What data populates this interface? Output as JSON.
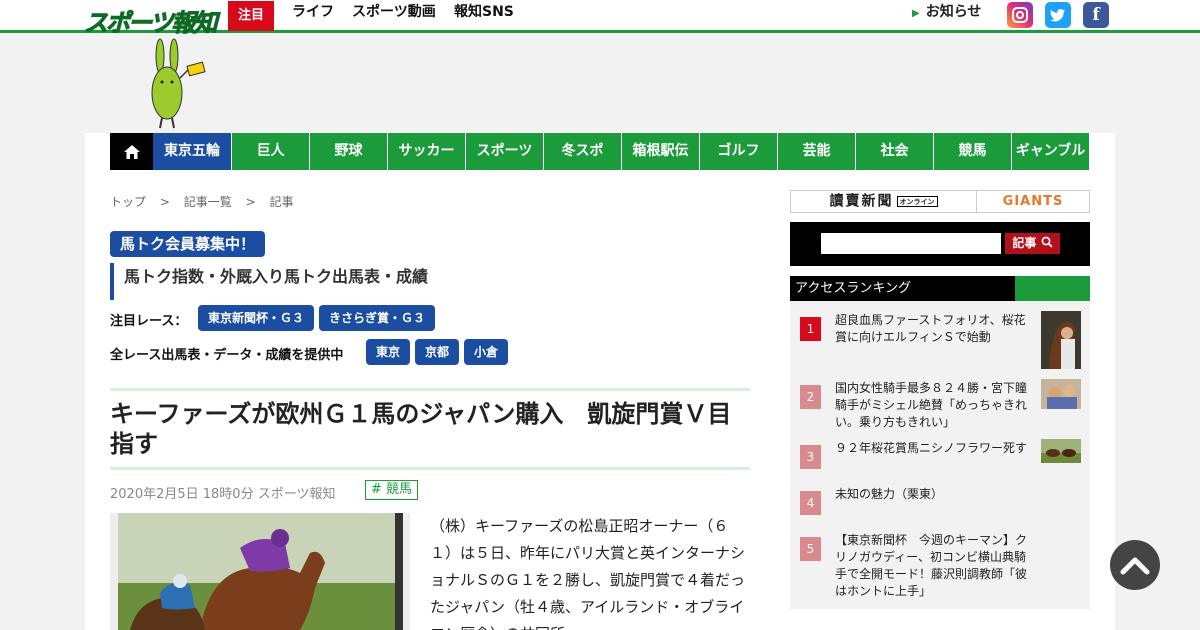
{
  "header": {
    "logo": "スポーツ報知",
    "hot_label": "注目",
    "nav": [
      "ライフ",
      "スポーツ動画",
      "報知SNS"
    ],
    "notice": "お知らせ",
    "sns": [
      "instagram-icon",
      "twitter-icon",
      "facebook-icon"
    ]
  },
  "categories": [
    "東京五輪",
    "巨人",
    "野球",
    "サッカー",
    "スポーツ",
    "冬スポ",
    "箱根駅伝",
    "ゴルフ",
    "芸能",
    "社会",
    "競馬",
    "ギャンブル"
  ],
  "breadcrumb": [
    "トップ",
    ">",
    "記事一覧",
    ">",
    "記事"
  ],
  "promo": {
    "member_badge": "馬トク会員募集中！",
    "subtitle": "馬トク指数・外厩入り馬トク出馬表・成績",
    "race_label": "注目レース：",
    "races": [
      "東京新聞杯・Ｇ３",
      "きさらぎ賞・Ｇ３"
    ],
    "all_label": "全レース出馬表・データ・成績を提供中",
    "venues": [
      "東京",
      "京都",
      "小倉"
    ]
  },
  "article": {
    "title": "キーファーズが欧州Ｇ１馬のジャパン購入　凱旋門賞Ｖ目指す",
    "meta": "2020年2月5日 18時0分  スポーツ報知",
    "tag": "# 競馬",
    "body": "（株）キーファーズの松島正昭オーナー（６１）は５日、昨年にパリ大賞と英インターナショナルＳのＧ１を２勝し、凱旋門賞で４着だったジャパン（牡４歳、アイルランド・オブライエン厩舎）の共同所"
  },
  "sidebar": {
    "yomiuri": "讀賣新聞",
    "yomiuri_small": "オンライン",
    "giants": "GIANTS",
    "search_button": "記事",
    "ranking_title": "アクセスランキング",
    "ranking": [
      {
        "rank": "1",
        "text": "超良血馬ファーストフォリオ、桜花賞に向けエルフィンＳで始動"
      },
      {
        "rank": "2",
        "text": "国内女性騎手最多８２４勝・宮下瞳騎手がミシェル絶賛「めっちゃきれい。乗り方もきれい」"
      },
      {
        "rank": "3",
        "text": "９２年桜花賞馬ニシノフラワー死す"
      },
      {
        "rank": "4",
        "text": "未知の魅力（栗東）"
      },
      {
        "rank": "5",
        "text": "【東京新聞杯　今週のキーマン】クリノガウディー、初コンビ横山典騎手で全開モード！藤沢則調教師「彼はホントに上手」"
      }
    ]
  },
  "colors": {
    "brand_green": "#1c9b3c",
    "accent_blue": "#1b4ea0",
    "rank_red": "#d60a1b",
    "rank_pink": "#d88a8f"
  }
}
